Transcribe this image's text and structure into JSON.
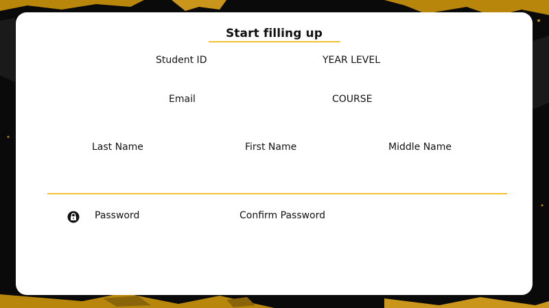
{
  "form": {
    "title": "Start filling up",
    "fields": {
      "student_id": {
        "label": "Student ID",
        "value": ""
      },
      "year_level": {
        "label": "YEAR LEVEL",
        "value": ""
      },
      "email": {
        "label": "Email",
        "value": ""
      },
      "course": {
        "label": "COURSE",
        "value": ""
      },
      "last_name": {
        "label": "Last Name",
        "value": ""
      },
      "first_name": {
        "label": "First Name",
        "value": ""
      },
      "middle_name": {
        "label": "Middle Name",
        "value": ""
      },
      "password": {
        "label": "Password",
        "value": ""
      },
      "confirm_password": {
        "label": "Confirm Password",
        "value": ""
      }
    }
  },
  "icons": {
    "password": "lock-icon"
  },
  "colors": {
    "accent": "#f2c12e",
    "card": "#ffffff",
    "background": "#0a0a0a"
  }
}
